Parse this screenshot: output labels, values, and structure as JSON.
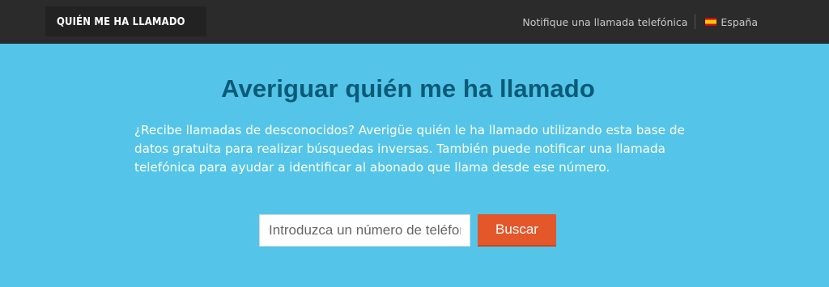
{
  "header": {
    "logo_text": "QUIÉN ME HA LLAMADO",
    "nav_report_link": "Notifique una llamada telefónica",
    "language_label": "España"
  },
  "hero": {
    "title": "Averiguar quién me ha llamado",
    "description": "¿Recibe llamadas de desconocidos? Averigüe quién le ha llamado utilizando esta base de datos gratuita para realizar búsquedas inversas. También puede notificar una llamada telefónica para ayudar a identificar al abonado que llama desde ese número."
  },
  "search": {
    "placeholder": "Introduzca un número de teléfono",
    "value": "",
    "button_label": "Buscar"
  },
  "colors": {
    "header_bg": "#2b2b2b",
    "page_bg": "#54c5e8",
    "title_color": "#0a5a78",
    "button_bg": "#e3572b",
    "logo_accent": "#e3452b"
  },
  "icons": {
    "logo": "phone-in-circle-icon",
    "language_flag": "spain-flag-icon"
  }
}
